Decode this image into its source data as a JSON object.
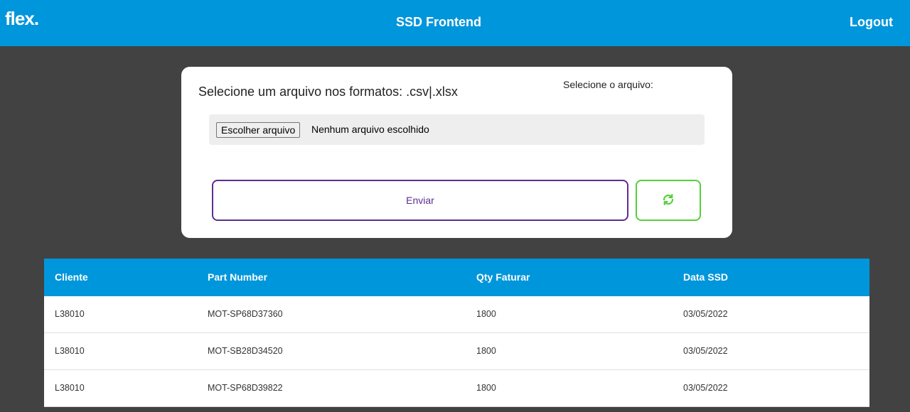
{
  "header": {
    "logo_text": "flex",
    "logo_dot": ".",
    "title": "SSD Frontend",
    "logout_label": "Logout"
  },
  "upload": {
    "title": "Selecione um arquivo nos formatos: .csv|.xlsx",
    "select_label": "Selecione o arquivo:",
    "choose_button": "Escolher arquivo",
    "file_status": "Nenhum arquivo escolhido",
    "send_label": "Enviar",
    "refresh_icon": "refresh-icon"
  },
  "table": {
    "headers": [
      "Cliente",
      "Part Number",
      "Qty Faturar",
      "Data SSD"
    ],
    "rows": [
      [
        "L38010",
        "MOT-SP68D37360",
        "1800",
        "03/05/2022"
      ],
      [
        "L38010",
        "MOT-SB28D34520",
        "1800",
        "03/05/2022"
      ],
      [
        "L38010",
        "MOT-SP68D39822",
        "1800",
        "03/05/2022"
      ]
    ]
  },
  "colors": {
    "header_bg": "#0096db",
    "background": "#424242",
    "send_accent": "#5b2d91",
    "refresh_accent": "#54d13a"
  }
}
